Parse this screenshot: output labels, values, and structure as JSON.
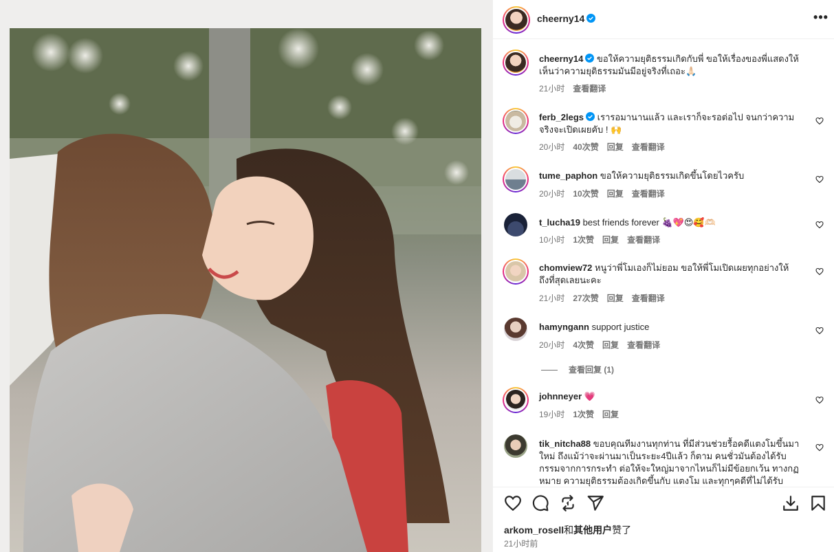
{
  "post": {
    "username": "cheerny14",
    "more_label": "•••"
  },
  "caption": {
    "author": "cheerny14",
    "text": "ขอให้ความยุติธรรมเกิดกับพี่ ขอให้เรื่องของพี่แสดงให้เห็นว่าความยุติธรรมมันมีอยู่จริงที่เถอะ🙏🏻",
    "time": "21小时",
    "translate": "查看翻译"
  },
  "comments": [
    {
      "author": "ferb_2legs",
      "verified": true,
      "text": "เรารอมานานแล้ว และเราก็จะรอต่อไป จนกว่าความจริงจะเปิดเผยคับ ! 🙌",
      "time": "20小时",
      "likes": "40次赞",
      "reply": "回复",
      "translate": "查看翻译"
    },
    {
      "author": "tume_paphon",
      "verified": false,
      "text": "ขอให้ความยุติธรรมเกิดขึ้นโดยไวครับ",
      "time": "20小时",
      "likes": "10次赞",
      "reply": "回复",
      "translate": "查看翻译"
    },
    {
      "author": "t_lucha19",
      "verified": false,
      "text": "best friends forever 🍇💖😍🥰🫶🏻",
      "time": "10小时",
      "likes": "1次赞",
      "reply": "回复",
      "translate": "查看翻译"
    },
    {
      "author": "chomview72",
      "verified": false,
      "text": "หนูว่าพี่โมเองก็ไม่ยอม ขอให้พี่โมเปิดเผยทุกอย่างให้ถึงที่สุดเลยนะคะ",
      "time": "21小时",
      "likes": "27次赞",
      "reply": "回复",
      "translate": "查看翻译"
    },
    {
      "author": "hamyngann",
      "verified": false,
      "text": "support justice",
      "time": "20小时",
      "likes": "4次赞",
      "reply": "回复",
      "translate": "查看翻译"
    },
    {
      "author": "johnneyer",
      "verified": false,
      "text": "💗",
      "time": "19小时",
      "likes": "1次赞",
      "reply": "回复"
    },
    {
      "author": "tik_nitcha88",
      "verified": false,
      "text": "ขอบคุณทีมงานทุกท่าน ที่มีส่วนช่วยรื้อคดีแตงโมขึ้นมาใหม่ ถึงแม้ว่าจะผ่านมาเป็นระยะ4ปีแล้ว ก็ตาม คนชั่วมันต้องได้รับกรรมจากการกระทำ ต่อให้จะใหญ่มาจากไหนก็ไม่มีข้อยกเว้น ทางกฏหมาย ความยุติธรรมต้องเกิดขึ้นกับ แตงโม และทุกๆคดีที่ไม่ได้รับความ"
    }
  ],
  "view_replies": "查看回复 (1)",
  "footer": {
    "liked_by_user": "arkom_rosell",
    "liked_by_and": "和",
    "liked_by_others": "其他用户",
    "liked_by_suffix": "赞了",
    "time": "21小时前"
  },
  "icons": {
    "header": [
      "verified-badge-icon",
      "more-options-icon"
    ],
    "actions": [
      "heart-icon",
      "comment-icon",
      "repost-icon",
      "share-icon",
      "save-icon",
      "bookmark-icon"
    ]
  },
  "colors": {
    "verified": "#0095f6",
    "meta_text": "#737373",
    "text": "#262626",
    "heart_emoji": "#e8336a"
  }
}
